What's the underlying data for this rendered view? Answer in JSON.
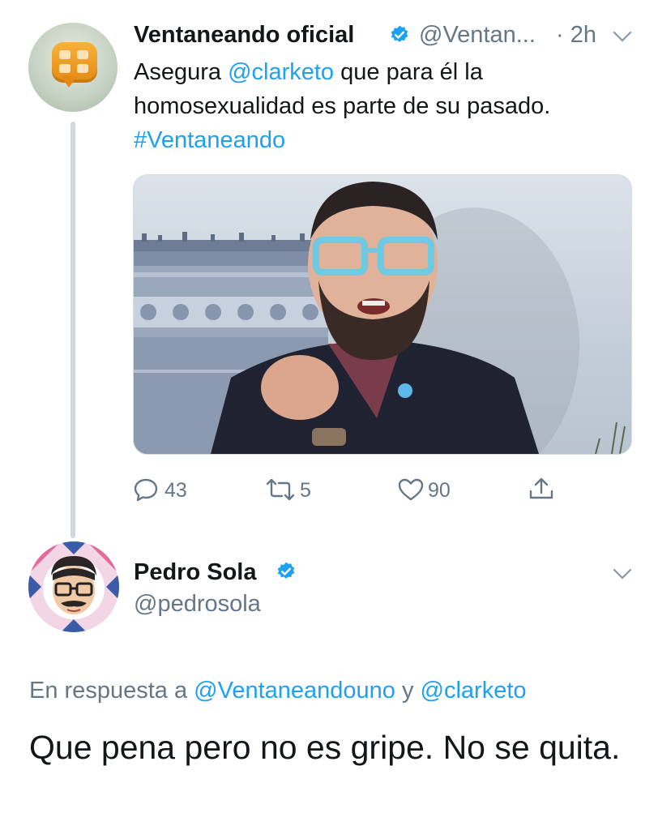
{
  "tweet1": {
    "author_name": "Ventaneando oficial",
    "author_handle": "@Ventan...",
    "time": "· 2h",
    "text_1": "Asegura",
    "mention": "@clarketo",
    "text_2": "que para él la homosexualidad es parte de su pasado.",
    "hashtag": "#Ventaneando",
    "replies": "43",
    "retweets": "5",
    "likes": "90"
  },
  "tweet2": {
    "author_name": "Pedro Sola",
    "author_handle": "@pedrosola",
    "replying_prefix": "En respuesta a",
    "replying_user1": "@Ventaneandouno",
    "replying_and": "y",
    "replying_user2": "@clarketo",
    "text": "Que pena pero no es gripe. No se quita."
  },
  "colors": {
    "link": "#1da1f2",
    "muted": "#657786",
    "text": "#14171a",
    "verified": "#1da1f2",
    "thread_line": "#cfd9de"
  },
  "icons": [
    "verified-badge-icon",
    "chevron-down-icon",
    "reply-icon",
    "retweet-icon",
    "like-icon",
    "share-icon"
  ]
}
